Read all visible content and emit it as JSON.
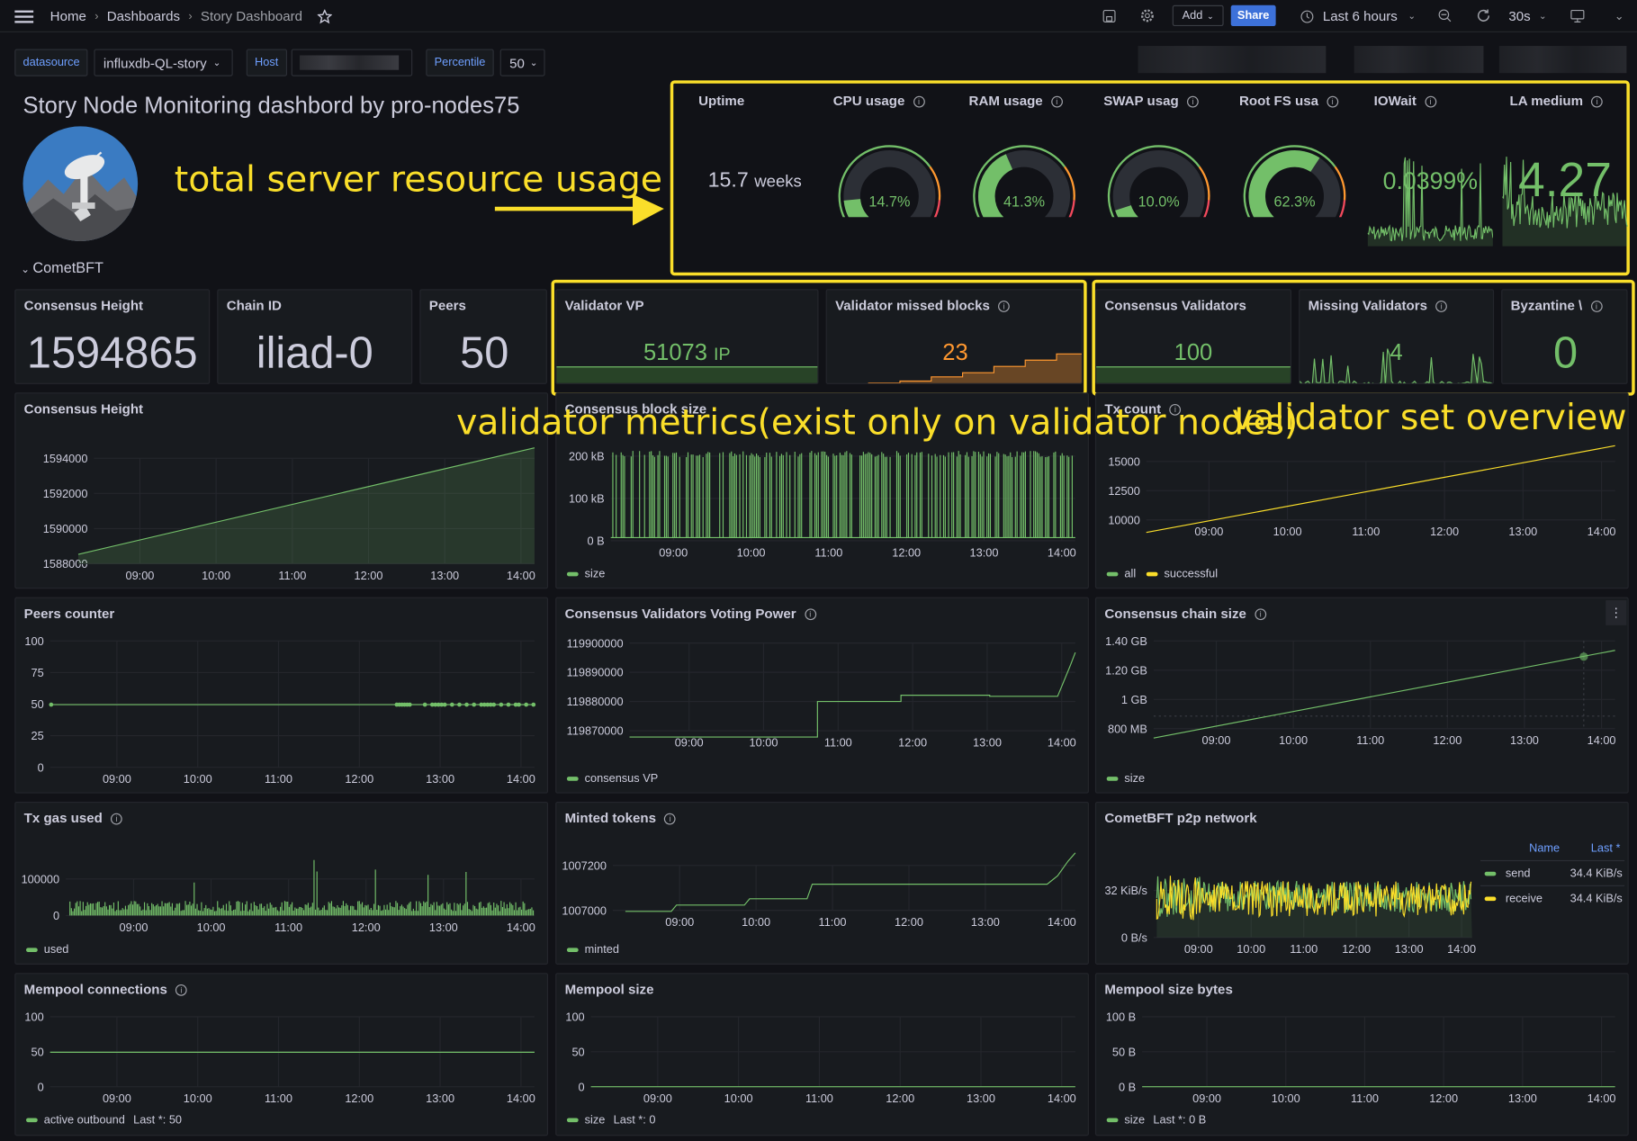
{
  "nav": {
    "home": "Home",
    "dashboards": "Dashboards",
    "current": "Story Dashboard"
  },
  "toolbar": {
    "add": "Add",
    "share": "Share",
    "time_range": "Last 6 hours",
    "refresh_interval": "30s"
  },
  "variables": [
    {
      "label": "datasource",
      "value": "influxdb-QL-story"
    },
    {
      "label": "Host",
      "value": ""
    },
    {
      "label": "Percentile",
      "value": "50"
    }
  ],
  "dashboard_title": "Story Node Monitoring dashbord by pro-nodes75",
  "row_title": "CometBFT",
  "annotations": {
    "resources": "total server resource usage",
    "validator": "validator metrics(exist only on validator nodes)",
    "valset": "validator set overview"
  },
  "colors": {
    "green": "#73bf69",
    "orange": "#ff9830",
    "yellow": "#fade2a",
    "blue": "#3d71d9",
    "red": "#f2495c"
  },
  "resource_stats": {
    "uptime": {
      "title": "Uptime",
      "value": "15.7",
      "unit": "weeks"
    },
    "cpu": {
      "title": "CPU usage",
      "value": "14.7%",
      "percent": 14.7
    },
    "ram": {
      "title": "RAM usage",
      "value": "41.3%",
      "percent": 41.3
    },
    "swap": {
      "title": "SWAP usag",
      "value": "10.0%",
      "percent": 10.0
    },
    "rootfs": {
      "title": "Root FS usa",
      "value": "62.3%",
      "percent": 62.3
    },
    "iowait": {
      "title": "IOWait",
      "value": "0.0399%"
    },
    "la": {
      "title": "LA medium",
      "value": "4.27"
    }
  },
  "stats": {
    "consensus_height": {
      "title": "Consensus Height",
      "value": "1594865"
    },
    "chain_id": {
      "title": "Chain ID",
      "value": "iliad-0"
    },
    "peers": {
      "title": "Peers",
      "value": "50"
    },
    "validator_vp": {
      "title": "Validator VP",
      "value": "51073",
      "unit": "IP"
    },
    "missed_blocks": {
      "title": "Validator missed blocks",
      "value": "23"
    },
    "consensus_validators": {
      "title": "Consensus Validators",
      "value": "100"
    },
    "missing_validators": {
      "title": "Missing Validators",
      "value": "4"
    },
    "byzantine": {
      "title": "Byzantine \\",
      "value": "0"
    }
  },
  "panels": {
    "height": {
      "title": "Consensus Height",
      "yticks": [
        "1594000",
        "1592000",
        "1590000",
        "1588000"
      ]
    },
    "block_size": {
      "title": "Consensus block size",
      "yticks": [
        "200 kB",
        "100 kB",
        "0 B"
      ],
      "legend": "size"
    },
    "tx_count": {
      "title": "Tx count",
      "yticks": [
        "15000",
        "12500",
        "10000"
      ],
      "legend_all": "all",
      "legend_successful": "successful"
    },
    "peers_counter": {
      "title": "Peers counter",
      "yticks": [
        "100",
        "75",
        "50",
        "25",
        "0"
      ]
    },
    "voting_power": {
      "title": "Consensus Validators Voting Power",
      "yticks": [
        "119900000",
        "119890000",
        "119880000",
        "119870000"
      ],
      "legend": "consensus VP"
    },
    "chain_size": {
      "title": "Consensus chain size",
      "yticks": [
        "1.40 GB",
        "1.20 GB",
        "1 GB",
        "800 MB"
      ],
      "legend": "size"
    },
    "gas_used": {
      "title": "Tx gas used",
      "yticks": [
        "100000",
        "0"
      ],
      "legend": "used"
    },
    "minted": {
      "title": "Minted tokens",
      "yticks": [
        "1007200",
        "1007000"
      ],
      "legend": "minted"
    },
    "p2p": {
      "title": "CometBFT p2p network",
      "yticks": [
        "32 KiB/s",
        "0 B/s"
      ],
      "legend_name_header": "Name",
      "legend_last_header": "Last *",
      "send": "send",
      "send_last": "34.4 KiB/s",
      "receive": "receive",
      "receive_last": "34.4 KiB/s"
    },
    "mempool_conn": {
      "title": "Mempool connections",
      "yticks": [
        "100",
        "50",
        "0"
      ],
      "legend": "active outbound",
      "legend_last": "Last *: 50"
    },
    "mempool_size": {
      "title": "Mempool size",
      "yticks": [
        "100",
        "50",
        "0"
      ],
      "legend": "size",
      "legend_last": "Last *: 0"
    },
    "mempool_bytes": {
      "title": "Mempool size bytes",
      "yticks": [
        "100 B",
        "50 B",
        "0 B"
      ],
      "legend": "size",
      "legend_last": "Last *: 0 B"
    }
  },
  "time_ticks": [
    "09:00",
    "10:00",
    "11:00",
    "12:00",
    "13:00",
    "14:00"
  ]
}
